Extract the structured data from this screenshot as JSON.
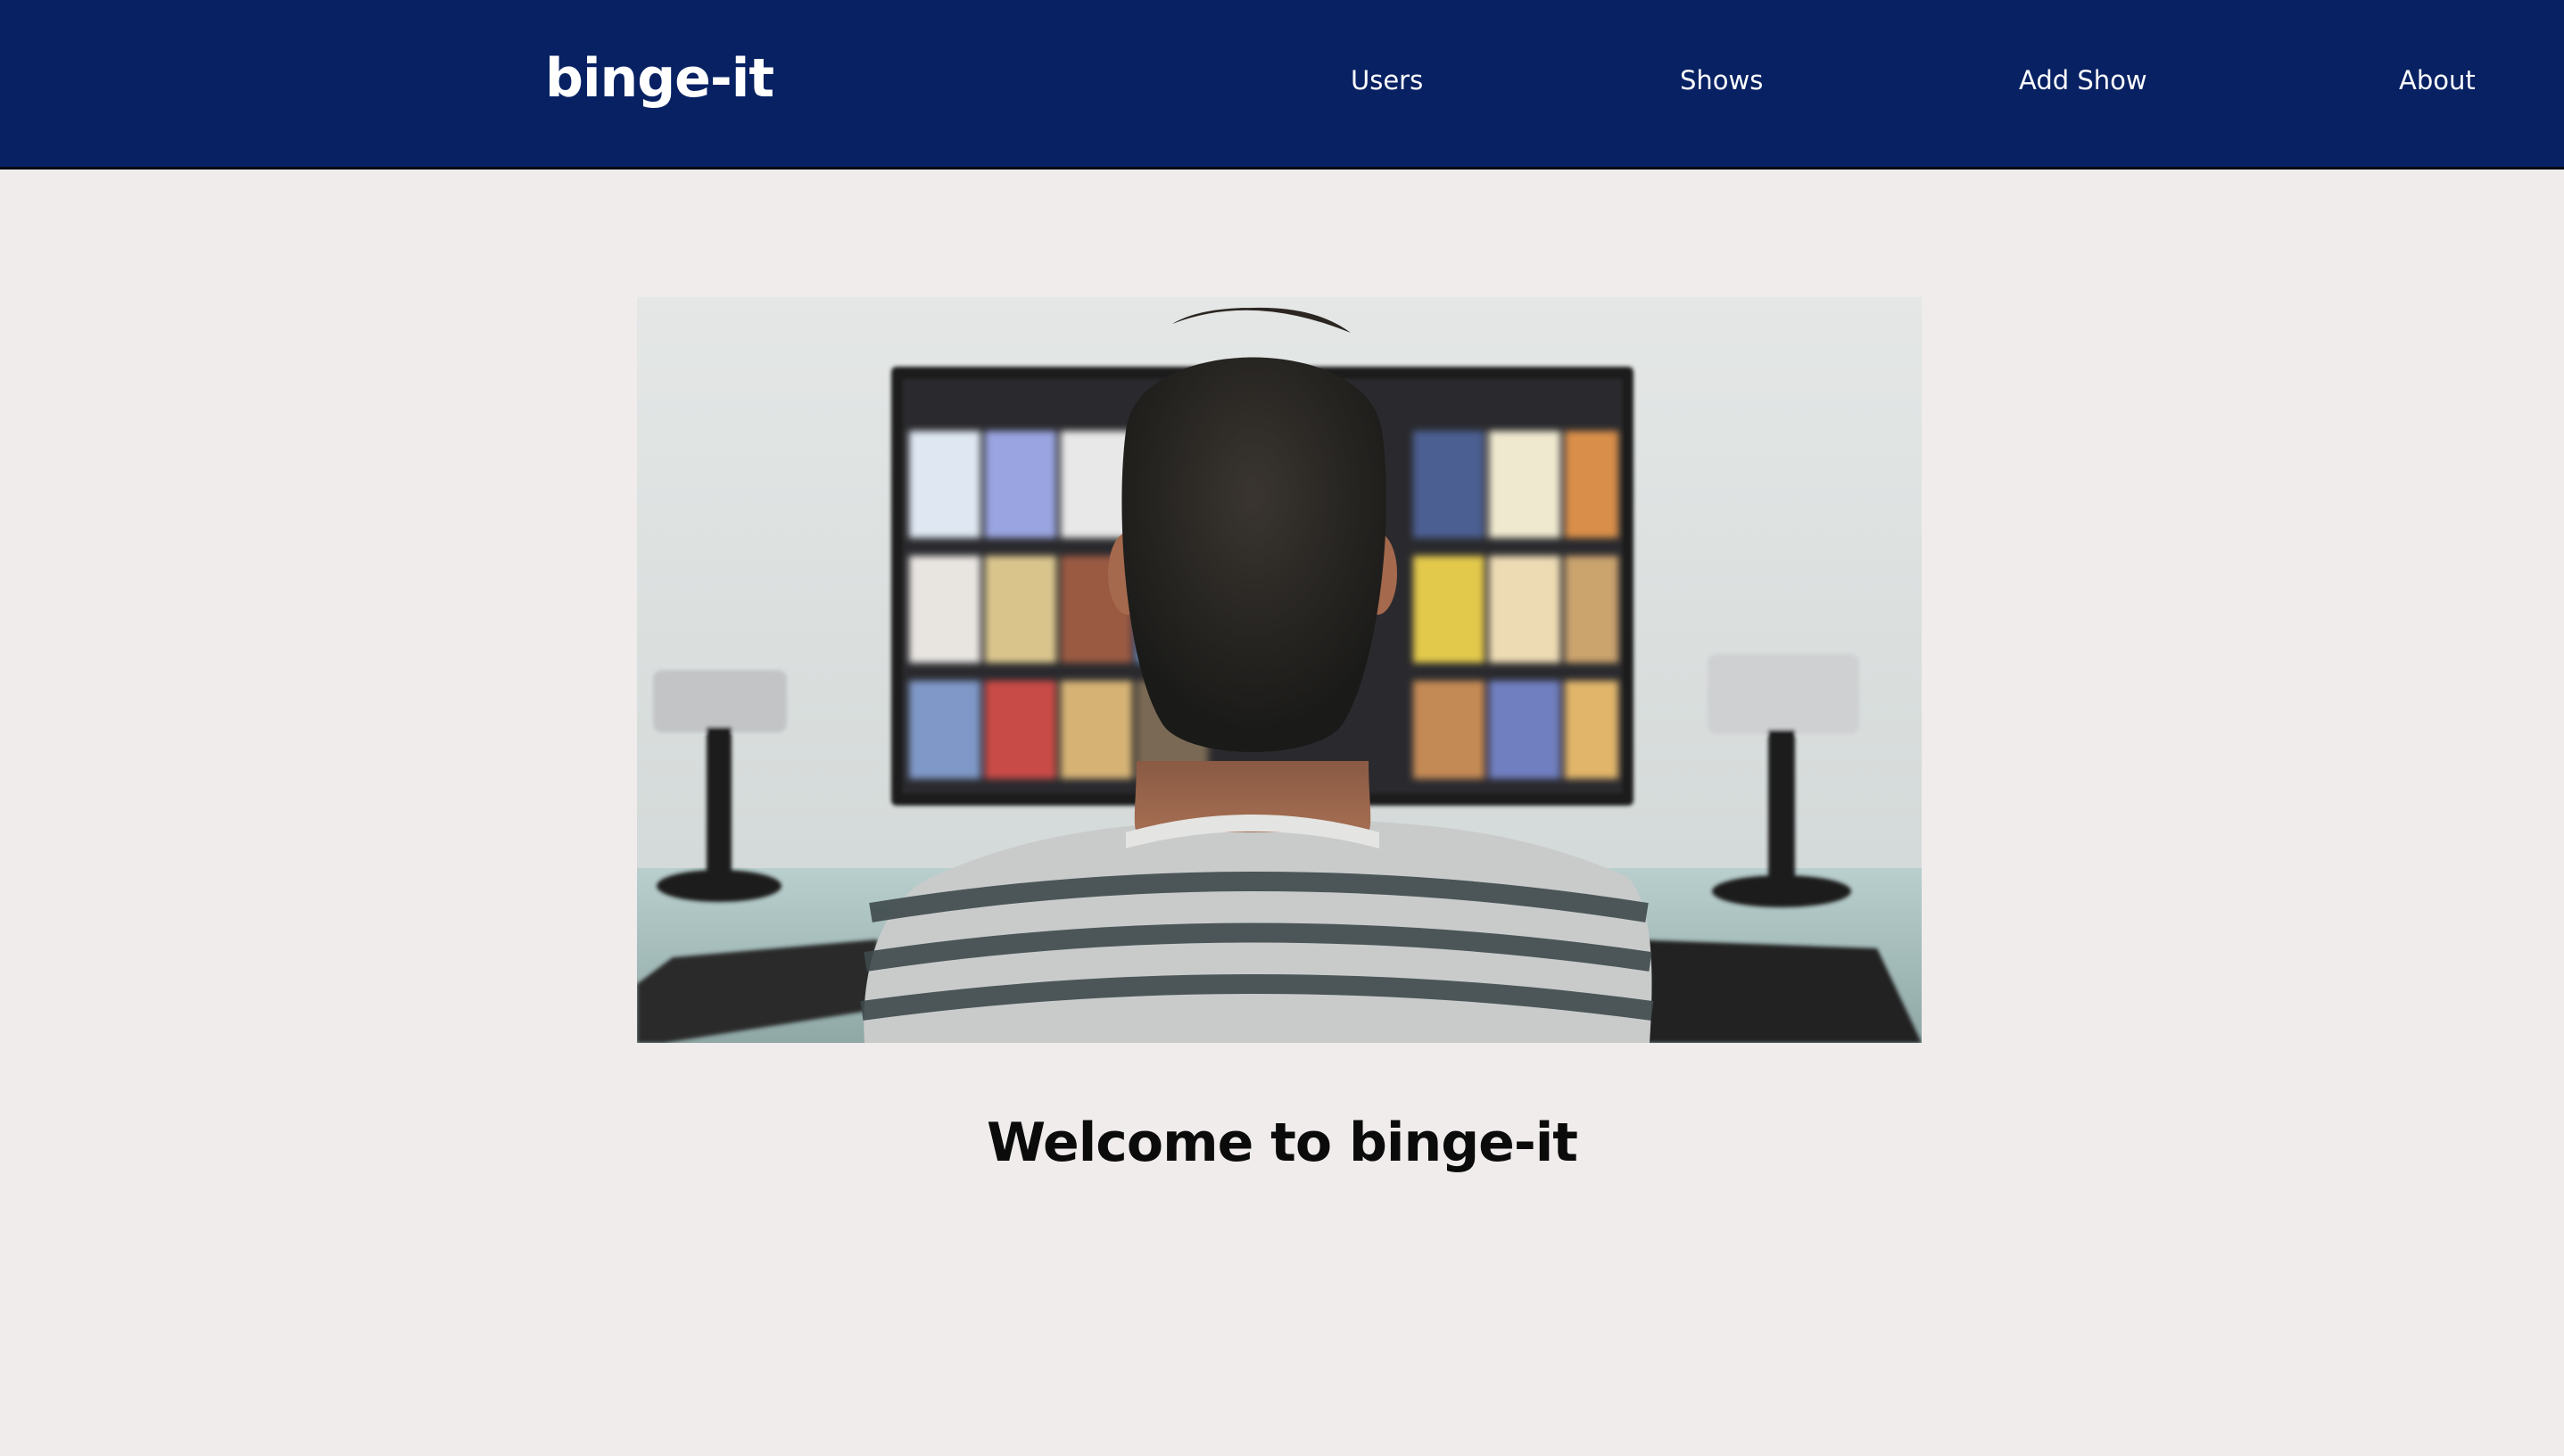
{
  "navbar": {
    "brand": "binge-it",
    "links": [
      {
        "label": "Users"
      },
      {
        "label": "Shows"
      },
      {
        "label": "Add Show"
      },
      {
        "label": "About"
      }
    ],
    "background_color": "#072163"
  },
  "hero": {
    "image_subject": "person-watching-tv-photo"
  },
  "main": {
    "heading": "Welcome to binge-it"
  }
}
